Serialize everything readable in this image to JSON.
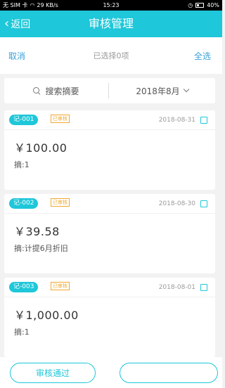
{
  "status_bar": {
    "carrier": "无 SIM 卡",
    "speed": "29 KB/s",
    "time": "15:23",
    "battery": "40%"
  },
  "nav": {
    "back_label": "返回",
    "title": "审核管理"
  },
  "actions": {
    "cancel": "取消",
    "selected_text": "已选择0项",
    "select_all": "全选"
  },
  "search": {
    "placeholder": "搜索摘要",
    "date": "2018年8月"
  },
  "cards": [
    {
      "no": "记-001",
      "badge": "已审核",
      "date": "2018-08-31",
      "amount": "￥100.00",
      "memo": "摘:1"
    },
    {
      "no": "记-002",
      "badge": "已审核",
      "date": "2018-08-30",
      "amount": "￥39.58",
      "memo": "摘:计提6月折旧"
    },
    {
      "no": "记-003",
      "badge": "已审核",
      "date": "2018-08-01",
      "amount": "￥1,000.00",
      "memo": "摘:1"
    }
  ],
  "bottom": {
    "approve": "审核通过",
    "reject": ""
  },
  "colors": {
    "accent": "#1ec7d9",
    "link": "#3aa0d8",
    "badge": "#f0a830"
  }
}
